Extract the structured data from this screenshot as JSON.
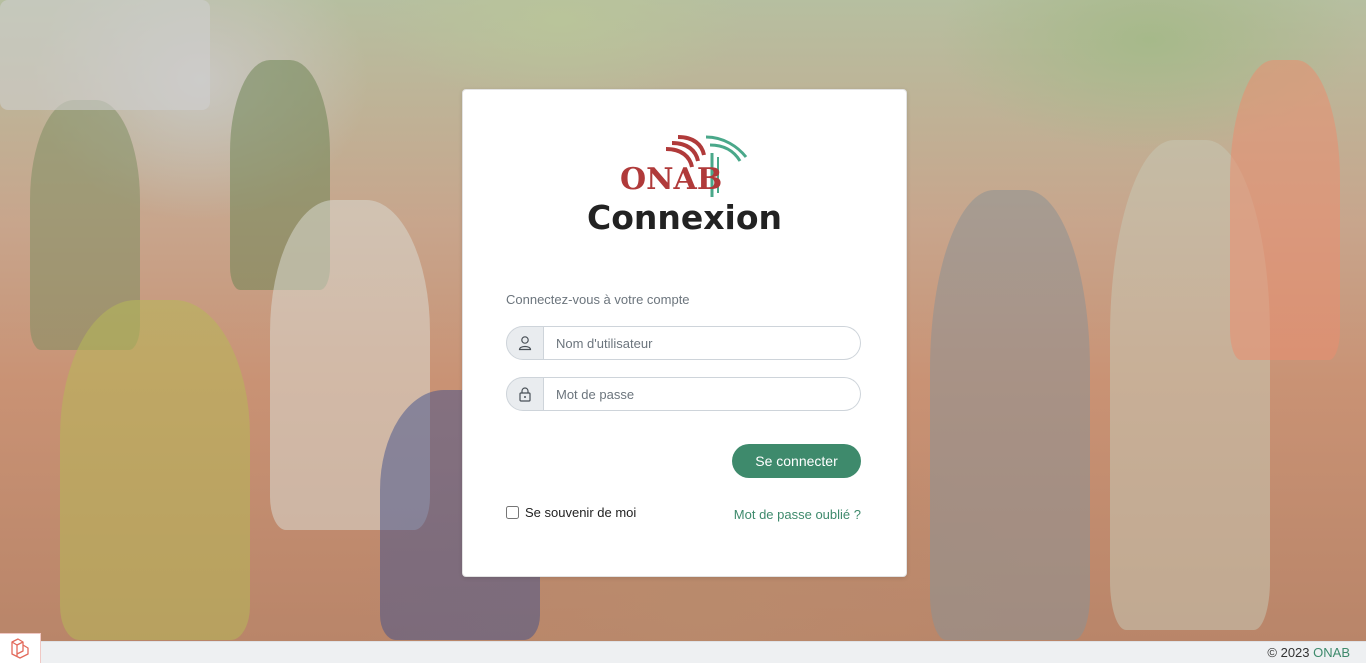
{
  "login": {
    "logo_text": "ONAB",
    "title": "Connexion",
    "subtitle": "Connectez-vous à votre compte",
    "username_placeholder": "Nom d'utilisateur",
    "password_placeholder": "Mot de passe",
    "submit_label": "Se connecter",
    "remember_label": "Se souvenir de moi",
    "forgot_label": "Mot de passe oublié ?"
  },
  "footer": {
    "copyright": "© 2023",
    "brand": "ONAB"
  },
  "colors": {
    "primary": "#3e8a6c",
    "logo_red": "#b03a3a",
    "logo_green": "#4aa88a"
  },
  "icons": {
    "user": "user-icon",
    "lock": "lock-icon",
    "framework": "laravel-logo-icon"
  }
}
